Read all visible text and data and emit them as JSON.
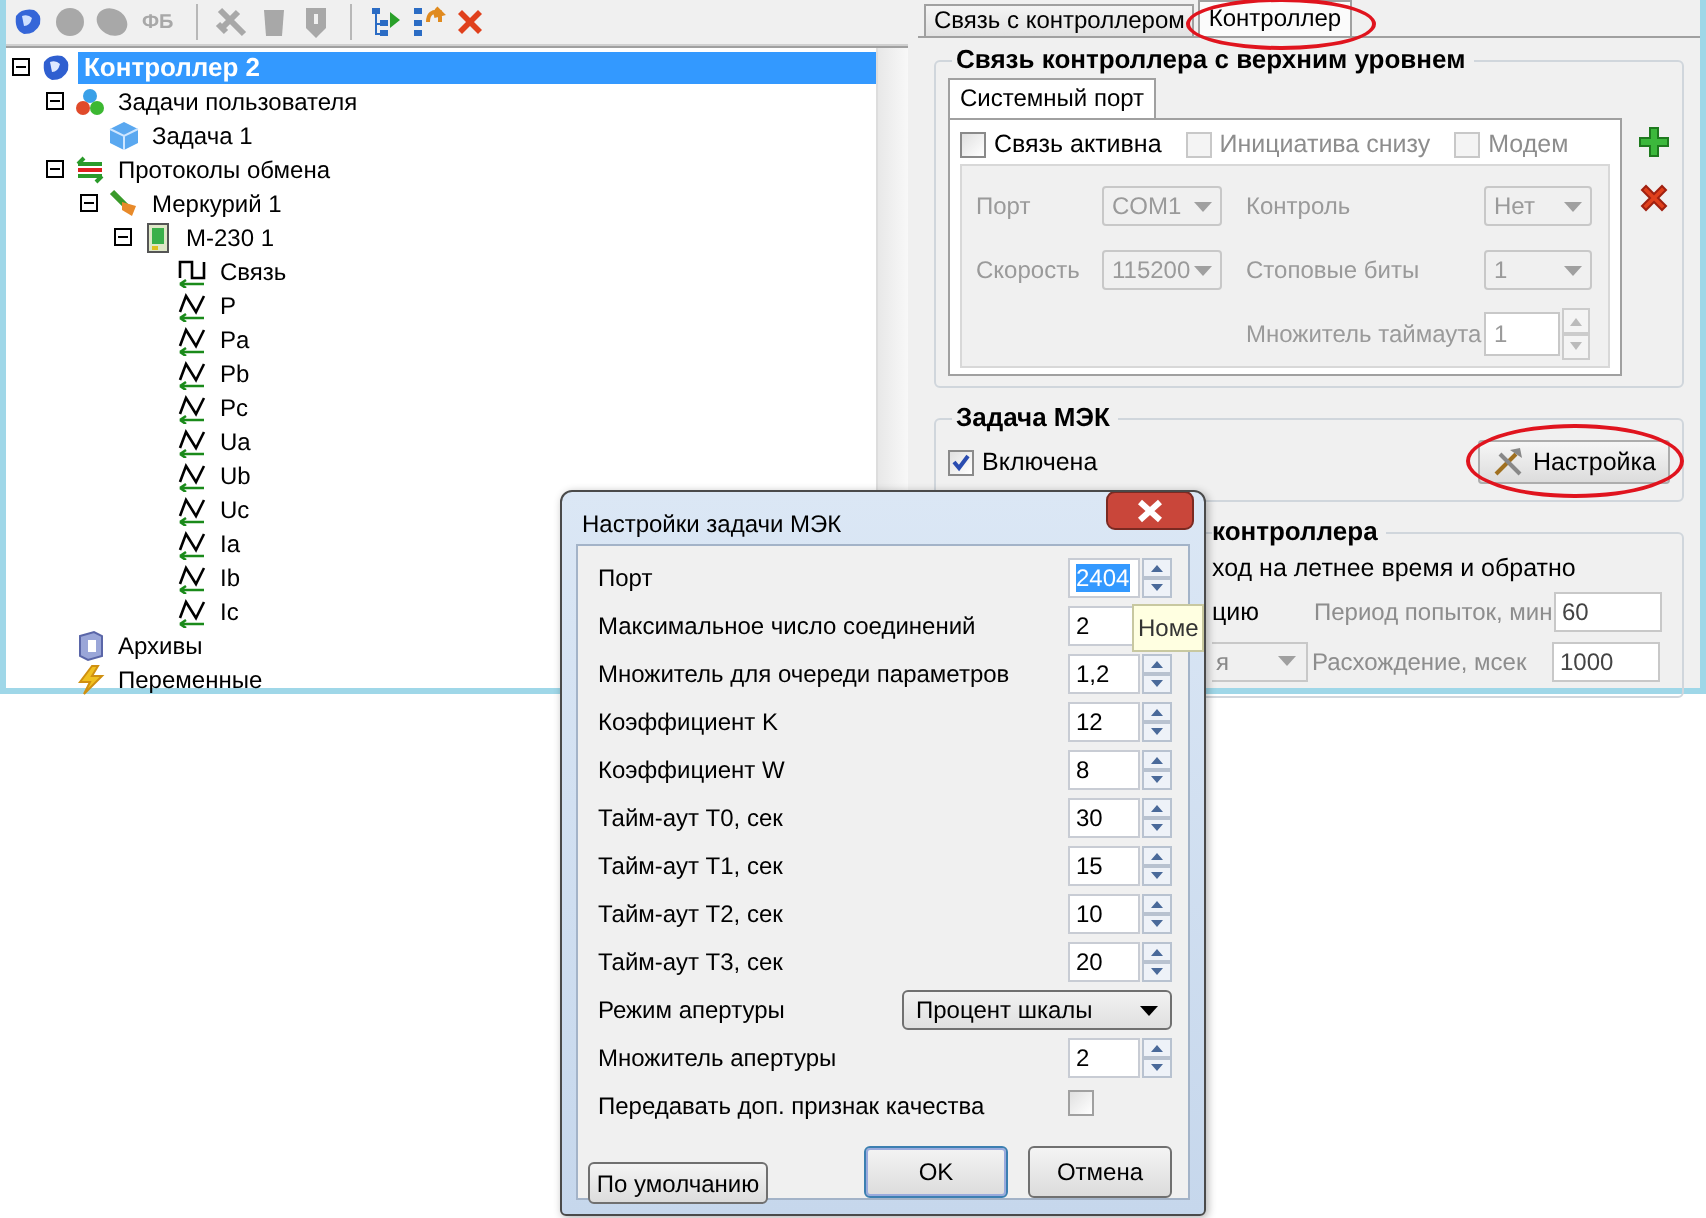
{
  "toolbar": {
    "buttons": [
      {
        "disabled": false
      },
      {
        "disabled": true
      },
      {
        "disabled": true
      },
      {
        "label": "ФБ",
        "disabled": true
      },
      {
        "disabled": true
      },
      {
        "disabled": true
      },
      {
        "disabled": true
      },
      {
        "disabled": false
      },
      {
        "disabled": false
      },
      {
        "disabled": false
      }
    ]
  },
  "tree": {
    "nodes": [
      {
        "label": "Контроллер 2",
        "kind": "controller",
        "selected": true,
        "expanded": true,
        "children": [
          {
            "label": "Задачи пользователя",
            "kind": "tasks",
            "selected": false,
            "expanded": true,
            "children": [
              {
                "label": "Задача 1",
                "kind": "task",
                "selected": false
              }
            ]
          },
          {
            "label": "Протоколы обмена",
            "kind": "protocols",
            "selected": false,
            "expanded": true,
            "children": [
              {
                "label": "Меркурий 1",
                "kind": "driver",
                "selected": false,
                "expanded": true,
                "children": [
                  {
                    "label": "М-230 1",
                    "kind": "device",
                    "selected": false,
                    "expanded": true,
                    "children": [
                      {
                        "label": "Связь",
                        "kind": "link",
                        "selected": false
                      },
                      {
                        "label": "P",
                        "kind": "param",
                        "selected": false
                      },
                      {
                        "label": "Pa",
                        "kind": "param",
                        "selected": false
                      },
                      {
                        "label": "Pb",
                        "kind": "param",
                        "selected": false
                      },
                      {
                        "label": "Pc",
                        "kind": "param",
                        "selected": false
                      },
                      {
                        "label": "Ua",
                        "kind": "param",
                        "selected": false
                      },
                      {
                        "label": "Ub",
                        "kind": "param",
                        "selected": false
                      },
                      {
                        "label": "Uc",
                        "kind": "param",
                        "selected": false
                      },
                      {
                        "label": "Ia",
                        "kind": "param",
                        "selected": false
                      },
                      {
                        "label": "Ib",
                        "kind": "param",
                        "selected": false
                      },
                      {
                        "label": "Ic",
                        "kind": "param",
                        "selected": false
                      }
                    ]
                  }
                ]
              }
            ]
          },
          {
            "label": "Архивы",
            "kind": "archive",
            "selected": false
          },
          {
            "label": "Переменные",
            "kind": "variables",
            "selected": false
          }
        ]
      }
    ]
  },
  "tabs": [
    {
      "label": "Связь с контроллером",
      "selected": false,
      "circled": false
    },
    {
      "label": "Контроллер",
      "selected": true,
      "circled": true
    }
  ],
  "uplink": {
    "title": "Связь контроллера с верхним уровнем",
    "tabs": [
      {
        "label": "Системный порт",
        "selected": true
      }
    ],
    "checks": [
      {
        "label": "Связь активна",
        "checked": false,
        "disabled": false
      },
      {
        "label": "Инициатива снизу",
        "checked": false,
        "disabled": true
      },
      {
        "label": "Модем",
        "checked": false,
        "disabled": true
      }
    ],
    "port": {
      "disabled": true,
      "rows": [
        {
          "left": {
            "label": "Порт",
            "value": "COM1",
            "kind": "select"
          },
          "right": {
            "label": "Контроль",
            "value": "Нет",
            "kind": "select"
          }
        },
        {
          "left": {
            "label": "Скорость",
            "value": "115200",
            "kind": "select"
          },
          "right": {
            "label": "Стоповые биты",
            "value": "1",
            "kind": "select"
          }
        },
        {
          "right": {
            "label": "Множитель таймаута",
            "value": "1",
            "kind": "spin"
          }
        }
      ]
    }
  },
  "iec_task": {
    "title": "Задача МЭК",
    "enabled": {
      "label": "Включена",
      "checked": true
    },
    "settings_button": {
      "label": "Настройка",
      "circled": true
    }
  },
  "clock": {
    "title": "контроллера",
    "dst_label": "ход на летнее время и обратно",
    "rows": [
      {
        "left": {
          "kind": "text",
          "label": "цию"
        },
        "right": {
          "label": "Период попыток, мин",
          "value": "60"
        }
      },
      {
        "left": {
          "kind": "select",
          "value": "я"
        },
        "right": {
          "label": "Расхождение, мсек",
          "value": "1000"
        }
      }
    ]
  },
  "dialog": {
    "title": "Настройки задачи МЭК",
    "fields": [
      {
        "kind": "spin",
        "label": "Порт",
        "value": "2404",
        "focused": true
      },
      {
        "kind": "spin",
        "label": "Максимальное число соединений",
        "value": "2",
        "focused": false
      },
      {
        "kind": "spin",
        "label": "Множитель для очереди параметров",
        "value": "1,2",
        "focused": false
      },
      {
        "kind": "spin",
        "label": "Коэффициент K",
        "value": "12",
        "focused": false
      },
      {
        "kind": "spin",
        "label": "Коэффициент W",
        "value": "8",
        "focused": false
      },
      {
        "kind": "spin",
        "label": "Тайм-аут T0, сек",
        "value": "30",
        "focused": false
      },
      {
        "kind": "spin",
        "label": "Тайм-аут T1, сек",
        "value": "15",
        "focused": false
      },
      {
        "kind": "spin",
        "label": "Тайм-аут T2, сек",
        "value": "10",
        "focused": false
      },
      {
        "kind": "spin",
        "label": "Тайм-аут T3, сек",
        "value": "20",
        "focused": false
      },
      {
        "kind": "select",
        "label": "Режим апертуры",
        "value": "Процент шкалы"
      },
      {
        "kind": "spin",
        "label": "Множитель апертуры",
        "value": "2",
        "focused": false
      },
      {
        "kind": "check",
        "label": "Передавать доп. признак качества",
        "checked": false
      }
    ],
    "buttons": [
      {
        "label": "По умолчанию",
        "default": false
      },
      {
        "label": "OK",
        "default": true
      },
      {
        "label": "Отмена",
        "default": false
      }
    ]
  },
  "tooltip": {
    "text": "Номе"
  }
}
